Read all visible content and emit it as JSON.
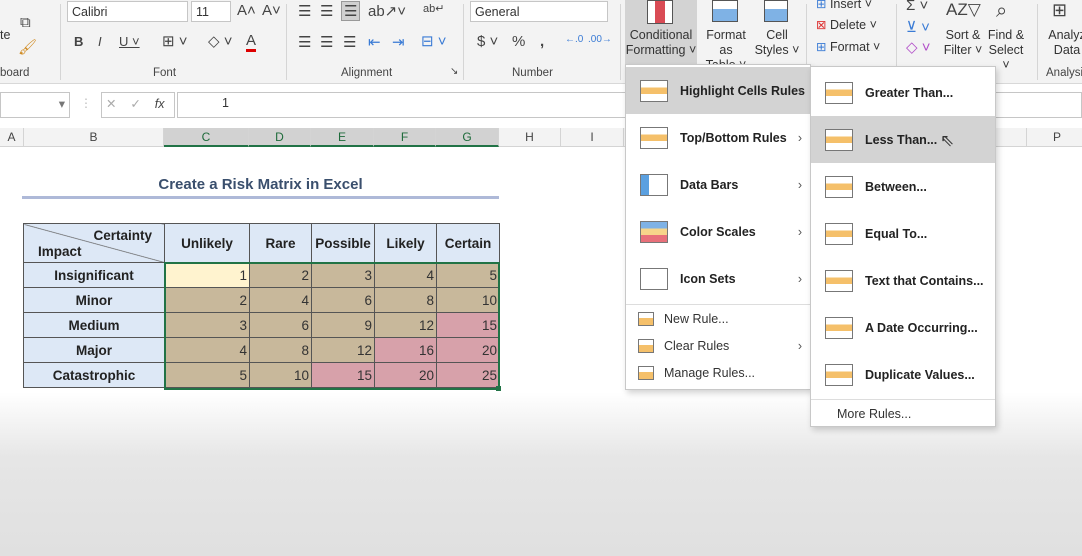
{
  "ribbon": {
    "clipboard_label": "board",
    "paste_label": "te",
    "font_name": "Calibri",
    "font_size": "11",
    "font_label": "Font",
    "alignment_label": "Alignment",
    "number_format": "General",
    "number_label": "Number",
    "conditional_formatting": [
      "Conditional",
      "Formatting ˅"
    ],
    "format_as_table": [
      "Format as",
      "Table ˅"
    ],
    "cell_styles": [
      "Cell",
      "Styles ˅"
    ],
    "insert": "Insert",
    "delete": "Delete",
    "format": "Format ˅",
    "sort_filter": [
      "Sort &",
      "Filter ˅"
    ],
    "find_select": [
      "Find &",
      "Select ˅"
    ],
    "analyze": [
      "Analyz",
      "Data"
    ],
    "analysis_label": "Analysi"
  },
  "formula_bar": {
    "value": "1",
    "fx": "fx"
  },
  "columns": [
    "A",
    "B",
    "C",
    "D",
    "E",
    "F",
    "G",
    "H",
    "I",
    "P"
  ],
  "sheet": {
    "title": "Create a Risk Matrix in Excel",
    "corner_top": "Certainty",
    "corner_bottom": "Impact",
    "col_headers": [
      "Unlikely",
      "Rare",
      "Possible",
      "Likely",
      "Certain"
    ],
    "rows": [
      {
        "label": "Insignificant",
        "values": [
          1,
          2,
          3,
          4,
          5
        ]
      },
      {
        "label": "Minor",
        "values": [
          2,
          4,
          6,
          8,
          10
        ]
      },
      {
        "label": "Medium",
        "values": [
          3,
          6,
          9,
          12,
          15
        ]
      },
      {
        "label": "Major",
        "values": [
          4,
          8,
          12,
          16,
          20
        ]
      },
      {
        "label": "Catastrophic",
        "values": [
          5,
          10,
          15,
          20,
          25
        ]
      }
    ],
    "colors": {
      "tan": "#c8b89b",
      "pink": "#d7a1aa",
      "light": "#fff3cf"
    }
  },
  "cf_menu": {
    "items": [
      "Highlight Cells Rules",
      "Top/Bottom Rules",
      "Data Bars",
      "Color Scales",
      "Icon Sets"
    ],
    "small_items": [
      "New Rule...",
      "Clear Rules",
      "Manage Rules..."
    ]
  },
  "highlight_submenu": {
    "items": [
      "Greater Than...",
      "Less Than...",
      "Between...",
      "Equal To...",
      "Text that Contains...",
      "A Date Occurring...",
      "Duplicate Values..."
    ],
    "more": "More Rules..."
  }
}
